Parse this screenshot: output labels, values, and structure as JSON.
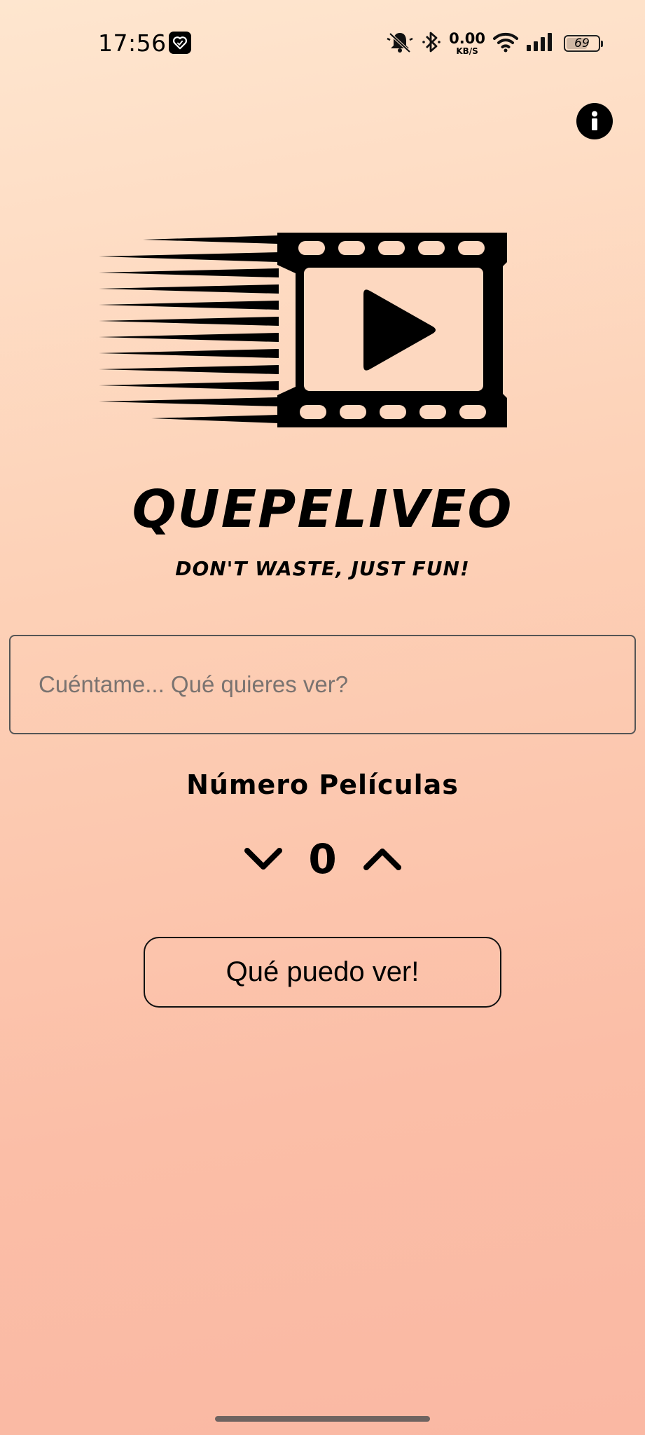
{
  "status_bar": {
    "time": "17:56",
    "net_speed_value": "0.00",
    "net_speed_unit": "KB/S",
    "battery_level": "69",
    "battery_fraction": 0.69,
    "icons": [
      "heart-app-notification-icon",
      "bell-muted-icon",
      "bluetooth-icon",
      "wifi-icon",
      "signal-icon",
      "battery-icon"
    ]
  },
  "header": {
    "info_icon": "info-icon"
  },
  "brand": {
    "title": "QUEPELIVEO",
    "tagline": "DON'T WASTE, JUST FUN!",
    "logo_icon": "film-strip-play-icon"
  },
  "search": {
    "placeholder": "Cuéntame... Qué quieres ver?",
    "value": ""
  },
  "movie_count": {
    "label": "Número Películas",
    "value": "0",
    "decrement_icon": "chevron-down-icon",
    "increment_icon": "chevron-up-icon"
  },
  "actions": {
    "submit_label": "Qué puedo ver!"
  },
  "colors": {
    "background_top": "#fee6cf",
    "background_bottom": "#fab8a3",
    "foreground": "#000000",
    "input_border": "#555555",
    "placeholder": "#7a7370"
  }
}
